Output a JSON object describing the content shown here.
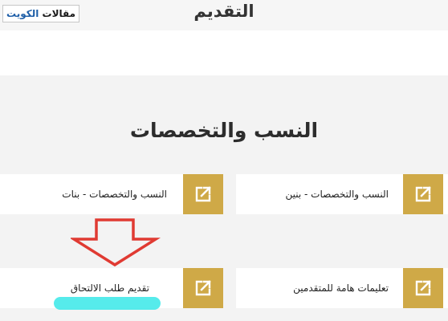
{
  "watermark": {
    "brand": "الكويت",
    "prefix": "مقالات"
  },
  "page": {
    "heading": "التقديم"
  },
  "section": {
    "title": "النسب والتخصصات"
  },
  "cards": [
    {
      "label": "النسب والتخصصات - بنين",
      "icon": "external-link-icon"
    },
    {
      "label": "النسب والتخصصات - بنات",
      "icon": "external-link-icon"
    },
    {
      "label": "تعليمات هامة للمتقدمين",
      "icon": "external-link-icon"
    },
    {
      "label": "تقديم طلب الالتحاق",
      "icon": "external-link-icon"
    }
  ],
  "colors": {
    "accent": "#cfa947",
    "arrow": "#e03a32",
    "highlight": "#38e8e8",
    "brand": "#1f5fa8"
  }
}
